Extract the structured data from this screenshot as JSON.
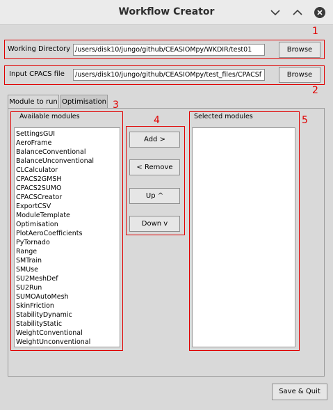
{
  "window": {
    "title": "Workflow Creator"
  },
  "working_directory": {
    "label": "Working Directory",
    "value": "/users/disk10/jungo/github/CEASIOMpy/WKDIR/test01",
    "browse_label": "Browse"
  },
  "input_cpacs": {
    "label": "Input CPACS file",
    "value": "/users/disk10/jungo/github/CEASIOMpy/test_files/CPACSf",
    "browse_label": "Browse"
  },
  "tabs": [
    {
      "label": "Module to run",
      "active": true
    },
    {
      "label": "Optimisation",
      "active": false
    }
  ],
  "available_modules": {
    "title": "Available modules",
    "items": [
      "SettingsGUI",
      "AeroFrame",
      "BalanceConventional",
      "BalanceUnconventional",
      "CLCalculator",
      "CPACS2GMSH",
      "CPACS2SUMO",
      "CPACSCreator",
      "ExportCSV",
      "ModuleTemplate",
      "Optimisation",
      "PlotAeroCoefficients",
      "PyTornado",
      "Range",
      "SMTrain",
      "SMUse",
      "SU2MeshDef",
      "SU2Run",
      "SUMOAutoMesh",
      "SkinFriction",
      "StabilityDynamic",
      "StabilityStatic",
      "WeightConventional",
      "WeightUnconventional"
    ]
  },
  "actions": {
    "add_label": "Add >",
    "remove_label": "< Remove",
    "up_label": "Up  ^",
    "down_label": "Down v"
  },
  "selected_modules": {
    "title": "Selected modules",
    "items": []
  },
  "save_quit_label": "Save & Quit",
  "annotations": [
    "1",
    "2",
    "3",
    "4",
    "5"
  ],
  "colors": {
    "annotation": "#e00000",
    "background": "#d9d9d9"
  }
}
